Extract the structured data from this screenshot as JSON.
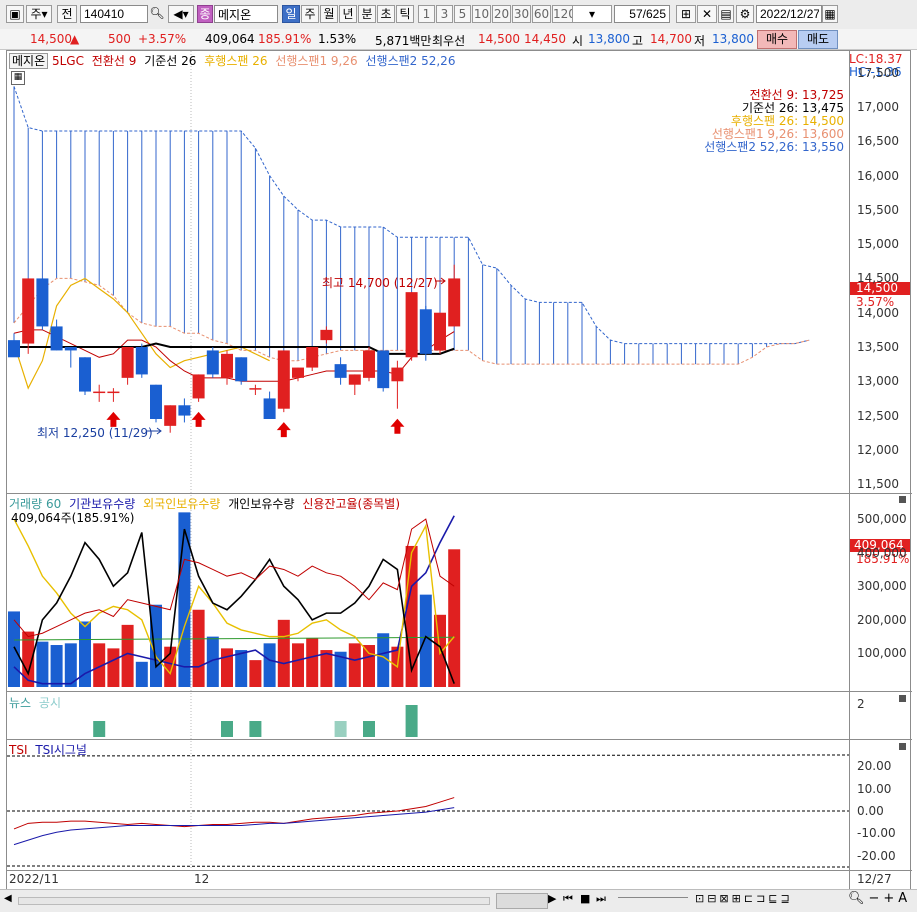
{
  "toolbar": {
    "period_label": "주",
    "prev_label": "전",
    "code": "140410",
    "stock_name": "메지온",
    "stock_badge": "종",
    "tf_buttons": [
      "일",
      "주",
      "월",
      "년",
      "분",
      "초",
      "틱"
    ],
    "num_buttons": [
      "1",
      "3",
      "5",
      "10",
      "20",
      "30",
      "60",
      "120"
    ],
    "page": "57/625",
    "date": "2022/12/27"
  },
  "quote": {
    "price": "14,500",
    "change_arrow": "▲",
    "change": "500",
    "change_pct": "+3.57%",
    "volume": "409,064",
    "vol_ratio": "185.91%",
    "turnover": "1.53%",
    "amount": "5,871백만",
    "best_label": "최우선",
    "ask": "14,500",
    "bid": "14,450",
    "open_label": "시",
    "open": "13,800",
    "high_label": "고",
    "high": "14,700",
    "low_label": "저",
    "low": "13,800",
    "buy_label": "매수",
    "sell_label": "매도"
  },
  "colors": {
    "up": "#e02020",
    "down": "#1a5fd1",
    "tenkan": "#c00000",
    "kijun": "#000000",
    "span_f": "#e8b000",
    "span1": "#e89070",
    "span2": "#3366cc"
  },
  "price_pane": {
    "legend": {
      "stock": "메지온",
      "five": "5LGC",
      "tenkan": "전환선 9",
      "kijun": "기준선 26",
      "lag": "후행스팬 26",
      "span1": "선행스팬1 9,26",
      "span2": "선행스팬2 52,26"
    },
    "lc": "LC:18.37",
    "hc": "HC:-1.36",
    "info": [
      "전환선 9: 13,725",
      "기준선 26: 13,475",
      "후행스팬 26: 14,500",
      "선행스팬1 9,26: 13,600",
      "선행스팬2 52,26: 13,550"
    ],
    "high_note": "최고 14,700 (12/27)",
    "low_note": "최저 12,250 (11/29)",
    "price_tag": "14,500",
    "pct_tag": "3.57%",
    "yticks": [
      "17,500",
      "17,000",
      "16,500",
      "16,000",
      "15,500",
      "15,000",
      "14,500",
      "14,000",
      "13,500",
      "13,000",
      "12,500",
      "12,000",
      "11,500"
    ]
  },
  "volume_pane": {
    "legend": {
      "vol": "거래량",
      "ma": "60",
      "inst": "기관보유수량",
      "foreign": "외국인보유수량",
      "indiv": "개인보유수량",
      "credit": "신용잔고율(종목별)"
    },
    "readout": "409,064주(185.91%)",
    "tag_value": "409,064",
    "tag_pct": "185.91%",
    "yticks": [
      "500,000",
      "400,000",
      "300,000",
      "200,000",
      "100,000"
    ]
  },
  "news_pane": {
    "news": "뉴스",
    "disclosure": "공시",
    "ytick": "2"
  },
  "tsi_pane": {
    "tsi": "TSI",
    "signal": "TSI시그널",
    "yticks": [
      "20.00",
      "10.00",
      "0.00",
      "-10.00",
      "-20.00"
    ]
  },
  "xaxis": {
    "left": "2022/11",
    "mid": "12",
    "right": "12/27"
  },
  "chart_data": {
    "type": "candlestick",
    "candles": [
      {
        "o": 13600,
        "h": 13700,
        "l": 13400,
        "c": 13350
      },
      {
        "o": 13550,
        "h": 14500,
        "l": 13400,
        "c": 14500
      },
      {
        "o": 14500,
        "h": 14500,
        "l": 13750,
        "c": 13800
      },
      {
        "o": 13800,
        "h": 13900,
        "l": 13450,
        "c": 13450
      },
      {
        "o": 13500,
        "h": 13500,
        "l": 13200,
        "c": 13450
      },
      {
        "o": 13350,
        "h": 13350,
        "l": 12800,
        "c": 12850
      },
      {
        "o": 12850,
        "h": 12950,
        "l": 12700,
        "c": 12850
      },
      {
        "o": 12850,
        "h": 12900,
        "l": 12700,
        "c": 12850
      },
      {
        "o": 13050,
        "h": 13500,
        "l": 12950,
        "c": 13500
      },
      {
        "o": 13500,
        "h": 13550,
        "l": 13050,
        "c": 13100
      },
      {
        "o": 12950,
        "h": 12950,
        "l": 12400,
        "c": 12450
      },
      {
        "o": 12350,
        "h": 12650,
        "l": 12250,
        "c": 12650
      },
      {
        "o": 12650,
        "h": 12750,
        "l": 12400,
        "c": 12500
      },
      {
        "o": 12750,
        "h": 13100,
        "l": 12700,
        "c": 13100
      },
      {
        "o": 13450,
        "h": 13500,
        "l": 13050,
        "c": 13100
      },
      {
        "o": 13050,
        "h": 13450,
        "l": 12950,
        "c": 13400
      },
      {
        "o": 13350,
        "h": 13350,
        "l": 12950,
        "c": 13000
      },
      {
        "o": 12900,
        "h": 12950,
        "l": 12800,
        "c": 12900
      },
      {
        "o": 12750,
        "h": 12850,
        "l": 12450,
        "c": 12450
      },
      {
        "o": 12600,
        "h": 13450,
        "l": 12550,
        "c": 13450
      },
      {
        "o": 13050,
        "h": 13200,
        "l": 13000,
        "c": 13200
      },
      {
        "o": 13200,
        "h": 13500,
        "l": 13150,
        "c": 13500
      },
      {
        "o": 13600,
        "h": 13800,
        "l": 13550,
        "c": 13750
      },
      {
        "o": 13250,
        "h": 13350,
        "l": 12950,
        "c": 13050
      },
      {
        "o": 12950,
        "h": 13100,
        "l": 12800,
        "c": 13100
      },
      {
        "o": 13050,
        "h": 13500,
        "l": 13000,
        "c": 13450
      },
      {
        "o": 13450,
        "h": 13450,
        "l": 12850,
        "c": 12900
      },
      {
        "o": 13000,
        "h": 13300,
        "l": 12600,
        "c": 13200
      },
      {
        "o": 13350,
        "h": 14300,
        "l": 13300,
        "c": 14300
      },
      {
        "o": 14050,
        "h": 14100,
        "l": 13300,
        "c": 13400
      },
      {
        "o": 13450,
        "h": 14000,
        "l": 13400,
        "c": 14000
      },
      {
        "o": 13800,
        "h": 14700,
        "l": 13800,
        "c": 14500
      }
    ],
    "volume": [
      225000,
      165000,
      135000,
      125000,
      130000,
      195000,
      130000,
      115000,
      185000,
      75000,
      245000,
      120000,
      520000,
      230000,
      150000,
      115000,
      110000,
      80000,
      130000,
      200000,
      130000,
      145000,
      110000,
      105000,
      130000,
      125000,
      160000,
      120000,
      420000,
      275000,
      215000,
      410000
    ],
    "tsi": [
      -8,
      -5.5,
      -5,
      -5,
      -4.5,
      -4.5,
      -5,
      -5.5,
      -6,
      -5.5,
      -6,
      -6.5,
      -7,
      -6.5,
      -6,
      -6,
      -5.5,
      -5,
      -5,
      -5.5,
      -4.5,
      -3.5,
      -3,
      -2.5,
      -2,
      -1,
      -0.5,
      0,
      1,
      2,
      4,
      6
    ],
    "tsi_signal": [
      -15,
      -13,
      -11,
      -9.5,
      -8.5,
      -8,
      -7.5,
      -7,
      -6.5,
      -6.5,
      -6.5,
      -6.5,
      -6.5,
      -6.5,
      -6.5,
      -6.5,
      -6.5,
      -6,
      -5.5,
      -5.5,
      -5,
      -4.5,
      -4,
      -3.5,
      -3,
      -2.5,
      -2,
      -1.5,
      -1,
      -0.5,
      0.5,
      1.5
    ],
    "ylim_price": [
      11400,
      17700
    ],
    "ylim_volume": [
      0,
      530000
    ],
    "ylim_tsi": [
      -25,
      25
    ]
  }
}
